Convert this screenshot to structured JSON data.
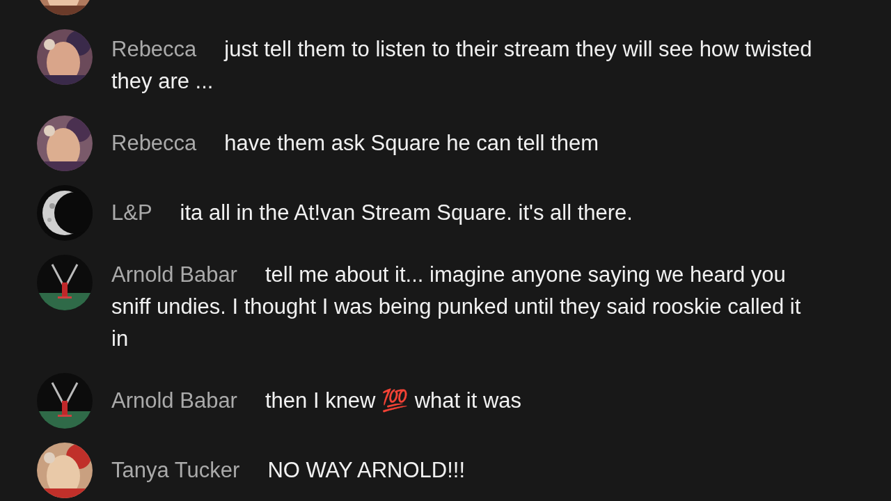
{
  "chat": {
    "messages": [
      {
        "avatar": {
          "kind": "picture"
        }
      },
      {
        "avatar": {
          "kind": "picture"
        },
        "author": "Rebecca",
        "message": "just tell them to listen to their stream they will see how twisted they are ..."
      },
      {
        "avatar": {
          "kind": "picture"
        },
        "author": "Rebecca",
        "message": "have them ask Square he can tell them"
      },
      {
        "avatar": {
          "kind": "picture"
        },
        "author": "L&P",
        "message": "ita all in the At!van Stream Square. it's all there."
      },
      {
        "avatar": {
          "kind": "picture"
        },
        "author": "Arnold Babar",
        "message": "tell me about it... imagine anyone saying we heard you sniff undies. I thought I was being punked until they said rooskie called it in"
      },
      {
        "avatar": {
          "kind": "picture"
        },
        "author": "Arnold Babar",
        "message": "then I knew 💯 what it was"
      },
      {
        "avatar": {
          "kind": "picture"
        },
        "author": "Tanya Tucker",
        "message": "NO WAY ARNOLD!!!"
      }
    ]
  }
}
